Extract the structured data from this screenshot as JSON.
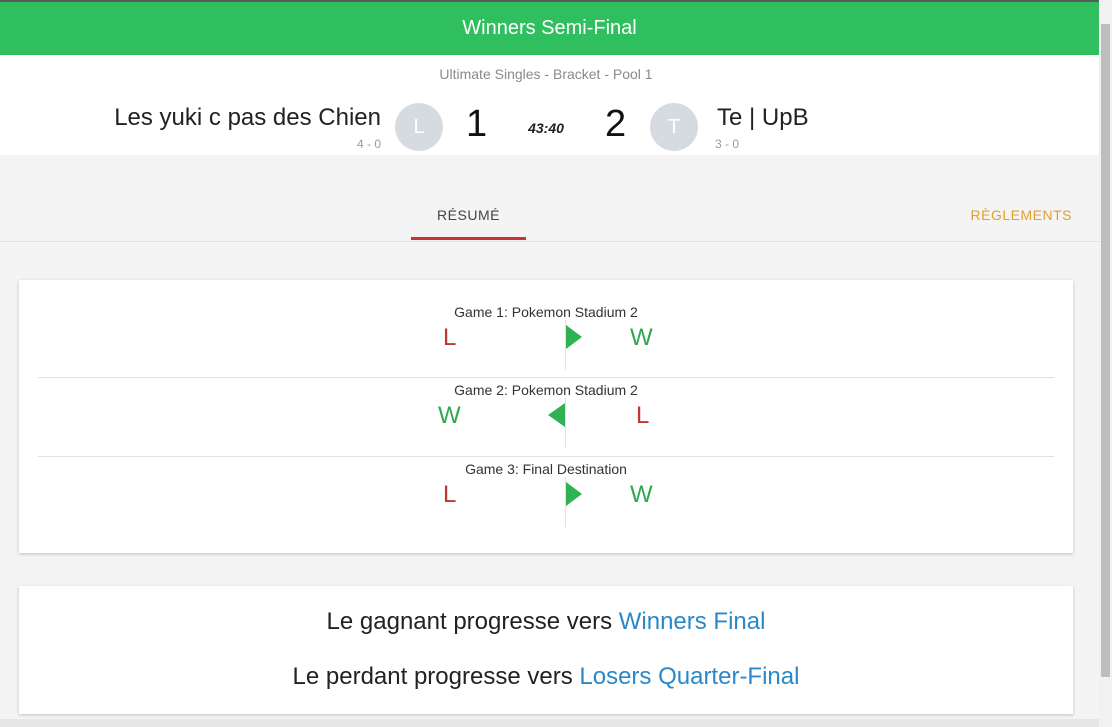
{
  "header": {
    "title": "Winners Semi-Final"
  },
  "match": {
    "subtitle": "Ultimate Singles - Bracket - Pool 1",
    "timer": "43:40",
    "team_left": {
      "name": "Les yuki c pas des Chien",
      "initial": "L",
      "record": "4 - 0",
      "score": "1"
    },
    "team_right": {
      "name": "Te | UpB",
      "initial": "T",
      "record": "3 - 0",
      "score": "2"
    }
  },
  "tabs": {
    "resume": "RÉSUMÉ",
    "rules": "RÈGLEMENTS"
  },
  "games": [
    {
      "title": "Game 1: Pokemon Stadium 2",
      "left": "L",
      "right": "W",
      "arrow": "right"
    },
    {
      "title": "Game 2: Pokemon Stadium 2",
      "left": "W",
      "right": "L",
      "arrow": "left"
    },
    {
      "title": "Game 3: Final Destination",
      "left": "L",
      "right": "W",
      "arrow": "right"
    }
  ],
  "progression": {
    "winner_prefix": "Le gagnant progresse vers",
    "winner_target": "Winners Final",
    "loser_prefix": "Le perdant progresse vers",
    "loser_target": "Losers Quarter-Final"
  },
  "colors": {
    "header": "#2fbf5f",
    "win": "#2fa84e",
    "loss": "#c03535",
    "link": "#2a88c9",
    "rules_tab": "#e0a030",
    "active_tab": "#cc3333"
  }
}
